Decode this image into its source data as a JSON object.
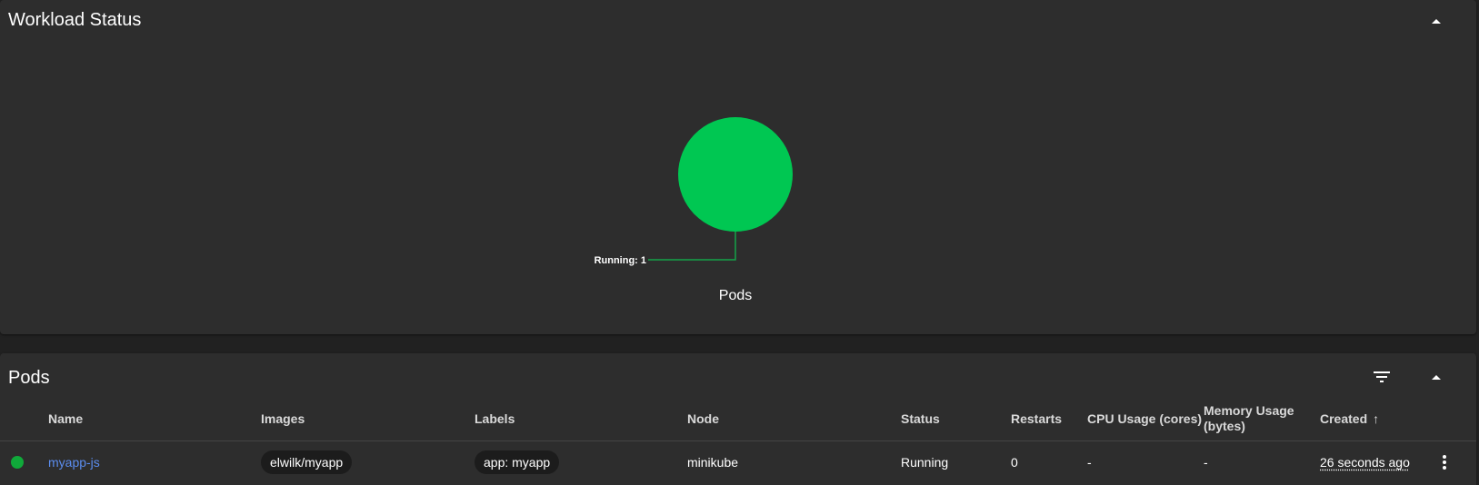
{
  "workload": {
    "title": "Workload Status",
    "chart_label": "Running: 1",
    "chart_title": "Pods"
  },
  "chart_data": {
    "type": "pie",
    "title": "Pods",
    "categories": [
      "Running"
    ],
    "values": [
      1
    ],
    "colors": [
      "#00c752"
    ]
  },
  "pods": {
    "title": "Pods",
    "columns": {
      "name": "Name",
      "images": "Images",
      "labels": "Labels",
      "node": "Node",
      "status": "Status",
      "restarts": "Restarts",
      "cpu": "CPU Usage (cores)",
      "memory_line1": "Memory Usage",
      "memory_line2": "(bytes)",
      "created": "Created",
      "sort_arrow": "↑"
    },
    "rows": [
      {
        "name": "myapp-js",
        "image": "elwilk/myapp",
        "label": "app: myapp",
        "node": "minikube",
        "status": "Running",
        "restarts": "0",
        "cpu": "-",
        "memory": "-",
        "created": "26 seconds ago",
        "status_color": "#10a93a"
      }
    ]
  },
  "icons": {
    "collapse": "chevron-up-icon",
    "filter": "filter-icon",
    "more": "more-vert-icon"
  }
}
